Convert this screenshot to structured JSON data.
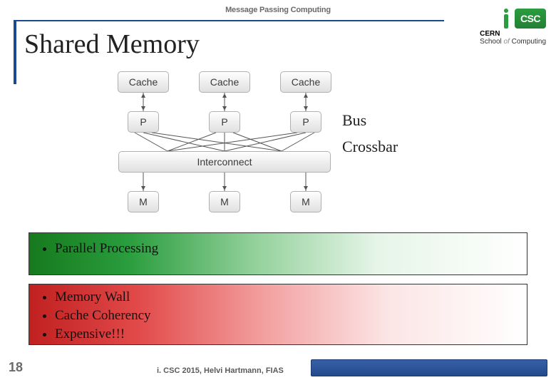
{
  "header": {
    "label": "Message Passing Computing"
  },
  "title": "Shared Memory",
  "logo": {
    "csc": "CSC",
    "line1_bold": "CERN",
    "line2_prefix": "School",
    "line2_of": "of",
    "line2_suffix": "Computing"
  },
  "diagram": {
    "cache_label": "Cache",
    "p_label": "P",
    "interconnect_label": "Interconnect",
    "m_label": "M",
    "side": {
      "bus": "Bus",
      "crossbar": "Crossbar"
    }
  },
  "pros": {
    "items": [
      "Parallel Processing"
    ]
  },
  "cons": {
    "items": [
      "Memory Wall",
      "Cache Coherency",
      "Expensive!!!"
    ]
  },
  "footer": {
    "page_number": "18",
    "citation": "i. CSC 2015, Helvi Hartmann, FIAS"
  }
}
